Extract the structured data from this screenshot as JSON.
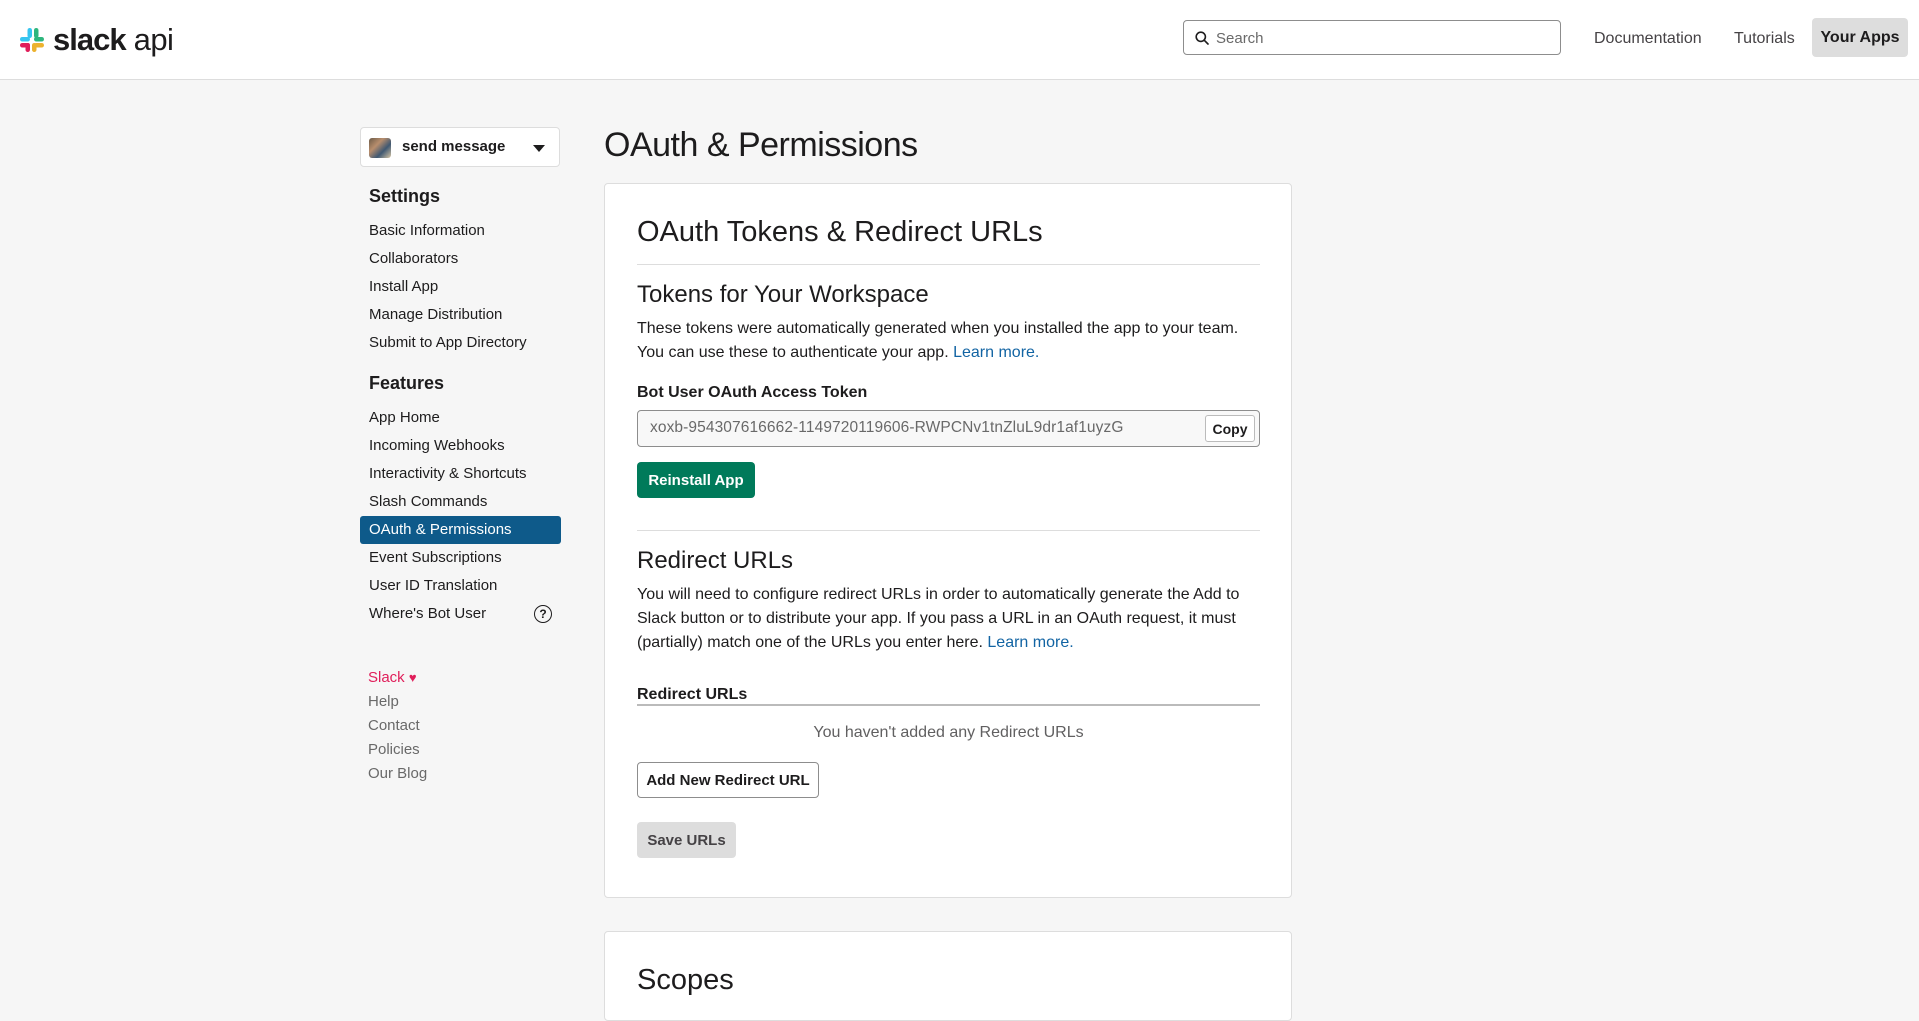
{
  "header": {
    "logo_word": "slack",
    "logo_api": "api",
    "search_placeholder": "Search",
    "nav": [
      "Documentation",
      "Tutorials",
      "Your Apps"
    ]
  },
  "sidebar": {
    "app_name": "send message",
    "settings_heading": "Settings",
    "settings_items": [
      {
        "label": "Basic Information"
      },
      {
        "label": "Collaborators"
      },
      {
        "label": "Install App"
      },
      {
        "label": "Manage Distribution"
      },
      {
        "label": "Submit to App Directory"
      }
    ],
    "features_heading": "Features",
    "features_items": [
      {
        "label": "App Home"
      },
      {
        "label": "Incoming Webhooks"
      },
      {
        "label": "Interactivity & Shortcuts"
      },
      {
        "label": "Slash Commands"
      },
      {
        "label": "OAuth & Permissions",
        "active": true
      },
      {
        "label": "Event Subscriptions"
      },
      {
        "label": "User ID Translation"
      },
      {
        "label": "Where's Bot User",
        "help": "?"
      }
    ],
    "footer": {
      "slack": "Slack",
      "heart": "♥",
      "links": [
        "Help",
        "Contact",
        "Policies",
        "Our Blog"
      ]
    }
  },
  "main": {
    "page_title": "OAuth & Permissions",
    "card1": {
      "title": "OAuth Tokens & Redirect URLs",
      "tokens_heading": "Tokens for Your Workspace",
      "tokens_desc": "These tokens were automatically generated when you installed the app to your team. You can use these to authenticate your app.",
      "learn_more": "Learn more.",
      "token_label": "Bot User OAuth Access Token",
      "token_value": "xoxb-954307616662-1149720119606-RWPCNv1tnZluL9dr1af1uyzG",
      "copy_label": "Copy",
      "reinstall_label": "Reinstall App",
      "redirect_heading": "Redirect URLs",
      "redirect_desc": "You will need to configure redirect URLs in order to automatically generate the Add to Slack button or to distribute your app. If you pass a URL in an OAuth request, it must (partially) match one of the URLs you enter here.",
      "redirect_learn_more": "Learn more.",
      "redirect_table_header": "Redirect URLs",
      "empty_state": "You haven't added any Redirect URLs",
      "add_redirect_label": "Add New Redirect URL",
      "save_urls_label": "Save URLs"
    },
    "card2": {
      "title": "Scopes"
    }
  },
  "colors": {
    "accent_blue": "#1264a3",
    "active_nav": "#0e5a8a",
    "primary_green": "#007a5a",
    "slack_pink": "#e01e5a"
  }
}
